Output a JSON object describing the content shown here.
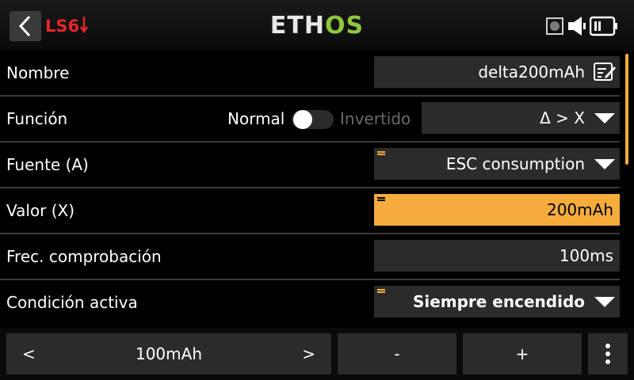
{
  "header": {
    "screen_id": "LS6",
    "logo": {
      "part1": "ETH",
      "part2": "OS"
    },
    "icons": [
      "back-arrow-icon",
      "rec-indicator-icon",
      "speaker-icon",
      "battery-icon"
    ]
  },
  "rows": {
    "nombre": {
      "label": "Nombre",
      "value": "delta200mAh",
      "icon": "edit-icon"
    },
    "funcion": {
      "label": "Función",
      "toggle_left": "Normal",
      "toggle_right": "Invertido",
      "toggle_on": false,
      "value": "Δ > X"
    },
    "fuente": {
      "label": "Fuente (A)",
      "value": "ESC consumption"
    },
    "valor": {
      "label": "Valor (X)",
      "value": "200mAh"
    },
    "frec": {
      "label": "Frec. comprobación",
      "value": "100ms"
    },
    "condicion": {
      "label": "Condición activa",
      "value": "Siempre encendido"
    }
  },
  "footer": {
    "prev": "<",
    "value": "100mAh",
    "next": ">",
    "minus": "-",
    "plus": "+",
    "more_icon": "kebab-menu-icon"
  },
  "colors": {
    "accent": "#f5ac3c",
    "screen_id": "#e3262a",
    "logo_green": "#8fc43f",
    "field_bg": "#2b2b2b"
  }
}
